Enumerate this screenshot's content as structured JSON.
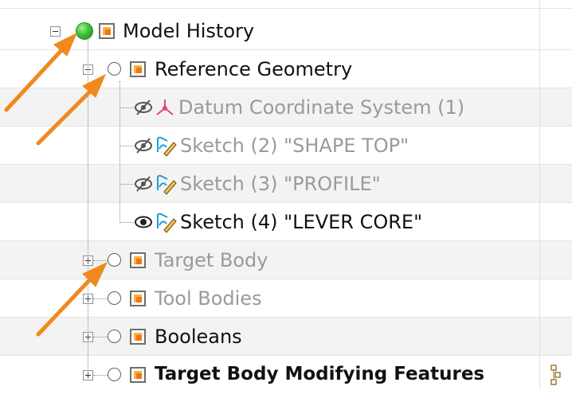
{
  "colors": {
    "active_green": "#3cc13c",
    "arrow_orange": "#f08a1e",
    "feature_orange": "#f0780f",
    "sketch_blue": "#1aa0d8",
    "datum_pink": "#e0467a",
    "dim_text": "#9a9a9a"
  },
  "tree": {
    "root": {
      "label": "Model History",
      "status_icon": "active-green-circle-icon",
      "type_icon": "feature-group-icon"
    },
    "reference_geometry": {
      "label": "Reference Geometry",
      "children": [
        {
          "label": "Datum Coordinate System (1)",
          "icon": "datum-csys-icon",
          "visibility": "hidden-eye-icon"
        },
        {
          "label": "Sketch (2) \"SHAPE TOP\"",
          "icon": "sketch-icon",
          "visibility": "hidden-eye-icon"
        },
        {
          "label": "Sketch (3) \"PROFILE\"",
          "icon": "sketch-icon",
          "visibility": "hidden-eye-icon"
        },
        {
          "label": "Sketch (4) \"LEVER CORE\"",
          "icon": "sketch-icon",
          "visibility": "visible-eye-icon"
        }
      ]
    },
    "groups": [
      {
        "label": "Target Body"
      },
      {
        "label": "Tool Bodies"
      },
      {
        "label": "Booleans"
      },
      {
        "label": "Target Body Modifying Features"
      }
    ]
  },
  "annotations": {
    "arrow_count": 3
  }
}
